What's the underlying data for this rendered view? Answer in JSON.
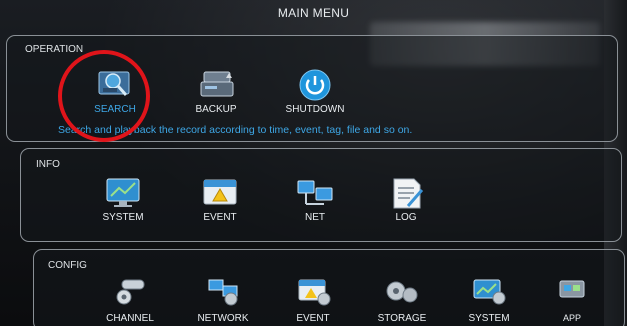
{
  "window": {
    "title": "MAIN MENU"
  },
  "sections": {
    "operation": {
      "title": "OPERATION",
      "items": [
        {
          "label": "SEARCH",
          "icon": "search-icon",
          "selected": true
        },
        {
          "label": "BACKUP",
          "icon": "backup-icon"
        },
        {
          "label": "SHUTDOWN",
          "icon": "power-icon"
        }
      ],
      "hint": "Search and playback the record according to time, event, tag, file and so on."
    },
    "info": {
      "title": "INFO",
      "items": [
        {
          "label": "SYSTEM",
          "icon": "monitor-icon"
        },
        {
          "label": "EVENT",
          "icon": "event-icon"
        },
        {
          "label": "NET",
          "icon": "network-icon"
        },
        {
          "label": "LOG",
          "icon": "log-icon"
        }
      ]
    },
    "config": {
      "title": "CONFIG",
      "items": [
        {
          "label": "CHANNEL",
          "icon": "camera-gear-icon"
        },
        {
          "label": "NETWORK",
          "icon": "network-gear-icon"
        },
        {
          "label": "EVENT",
          "icon": "event-gear-icon"
        },
        {
          "label": "STORAGE",
          "icon": "storage-gear-icon"
        },
        {
          "label": "SYSTEM",
          "icon": "system-gear-icon"
        },
        {
          "label": "APP",
          "icon": "app-icon"
        }
      ]
    }
  },
  "colors": {
    "accent": "#3ea7e6",
    "highlight_ring": "#e0141a",
    "panel_border": "#8a9096"
  }
}
